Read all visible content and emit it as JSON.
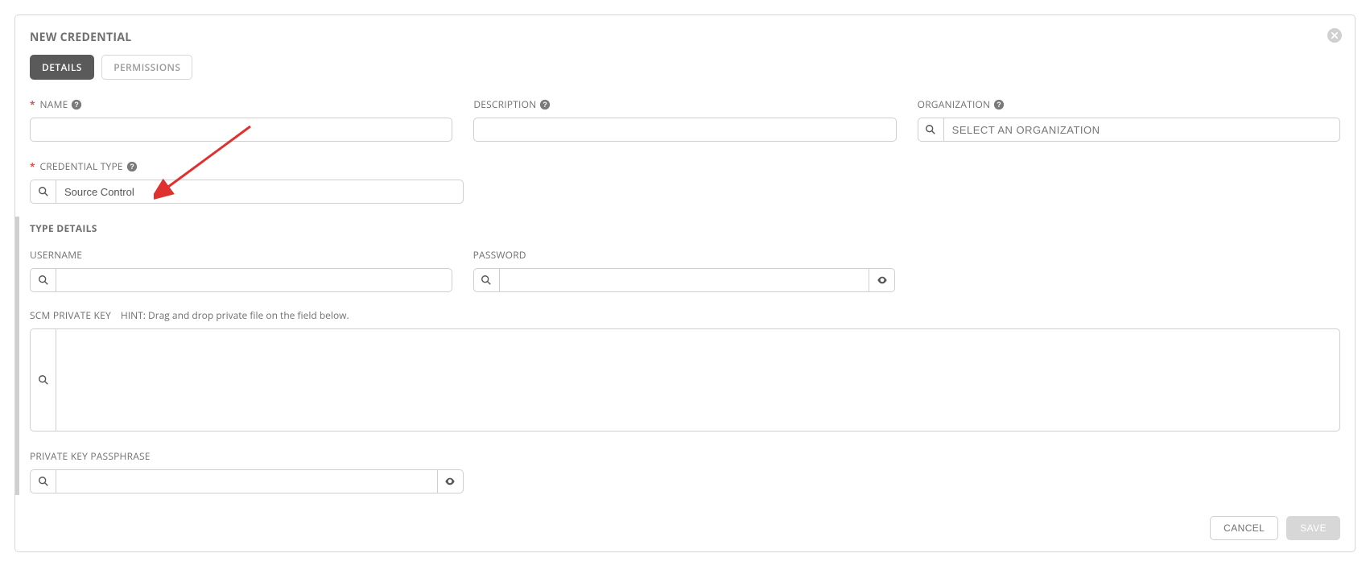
{
  "panel": {
    "title": "NEW CREDENTIAL"
  },
  "tabs": {
    "details": "DETAILS",
    "permissions": "PERMISSIONS"
  },
  "fields": {
    "name": {
      "label": "NAME"
    },
    "description": {
      "label": "DESCRIPTION"
    },
    "organization": {
      "label": "ORGANIZATION",
      "placeholder": "SELECT AN ORGANIZATION"
    },
    "credential_type": {
      "label": "CREDENTIAL TYPE",
      "value": "Source Control"
    }
  },
  "type_details": {
    "title": "TYPE DETAILS",
    "username": {
      "label": "USERNAME"
    },
    "password": {
      "label": "PASSWORD"
    },
    "scm_private_key": {
      "label": "SCM PRIVATE KEY",
      "hint": "HINT: Drag and drop private file on the field below."
    },
    "passphrase": {
      "label": "PRIVATE KEY PASSPHRASE"
    }
  },
  "buttons": {
    "cancel": "CANCEL",
    "save": "SAVE"
  }
}
